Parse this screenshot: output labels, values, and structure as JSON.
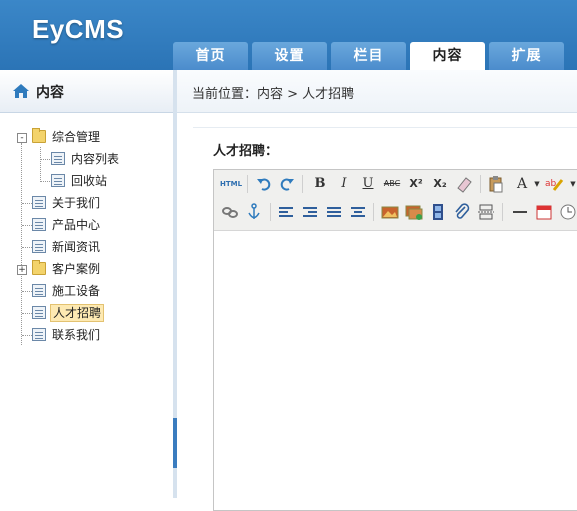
{
  "app": {
    "logo": "EyCMS"
  },
  "nav": {
    "tabs": [
      {
        "label": "首页",
        "active": false
      },
      {
        "label": "设置",
        "active": false
      },
      {
        "label": "栏目",
        "active": false
      },
      {
        "label": "内容",
        "active": true
      },
      {
        "label": "扩展",
        "active": false
      }
    ]
  },
  "sidebar": {
    "title": "内容",
    "tree": [
      {
        "label": "综合管理",
        "icon": "folder-icon",
        "expander": "-"
      },
      {
        "label": "内容列表",
        "icon": "page-icon"
      },
      {
        "label": "回收站",
        "icon": "page-icon"
      },
      {
        "label": "关于我们",
        "icon": "page-icon"
      },
      {
        "label": "产品中心",
        "icon": "page-icon"
      },
      {
        "label": "新闻资讯",
        "icon": "page-icon"
      },
      {
        "label": "客户案例",
        "icon": "folder-icon",
        "expander": "+"
      },
      {
        "label": "施工设备",
        "icon": "page-icon"
      },
      {
        "label": "人才招聘",
        "icon": "page-icon",
        "selected": true
      },
      {
        "label": "联系我们",
        "icon": "page-icon"
      }
    ]
  },
  "breadcrumb": {
    "text": "当前位置：内容 > 人才招聘"
  },
  "form": {
    "label": "人才招聘："
  },
  "editor": {
    "toolbar_row1": {
      "html": "HTML",
      "bold": "B",
      "italic": "I",
      "underline": "U",
      "strike": "ABC",
      "superscript": "X²",
      "subscript": "X₂",
      "font_color": "A"
    }
  },
  "colors": {
    "header": "#2f7bbd",
    "tab": "#5a9bd6",
    "accent": "#3a7cbf",
    "selected": "#fde9b2"
  }
}
